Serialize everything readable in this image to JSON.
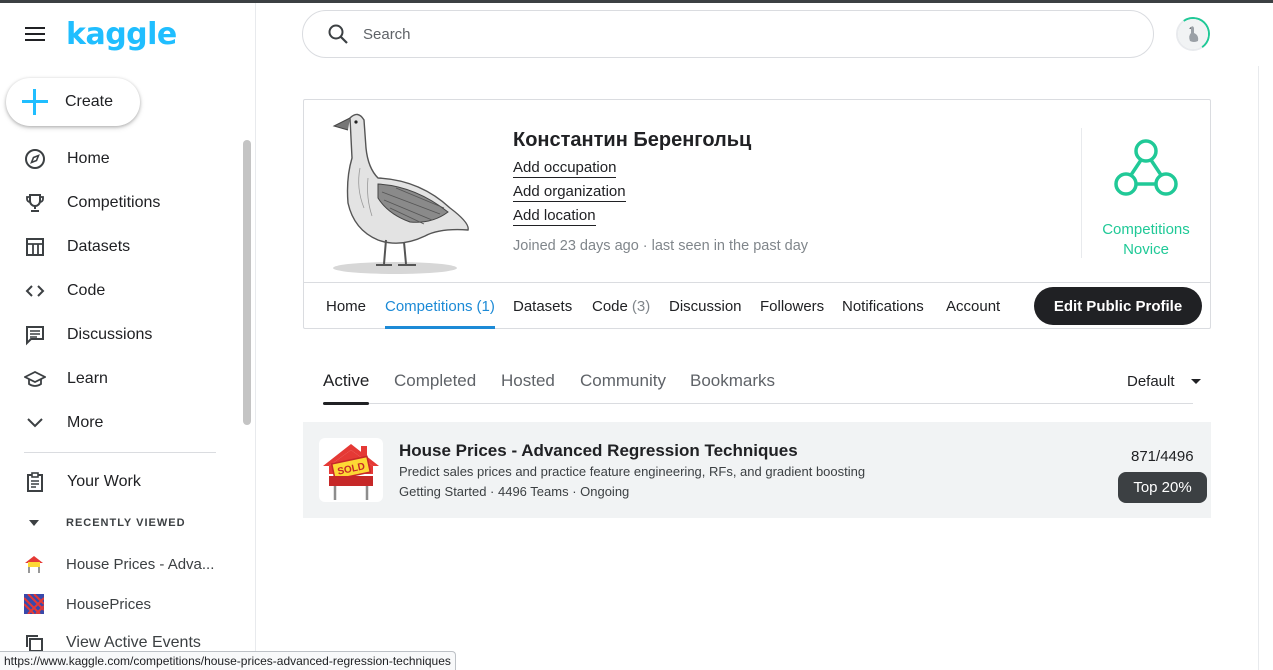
{
  "app": {
    "logo": "kaggle"
  },
  "sidebar": {
    "create_label": "Create",
    "items": [
      {
        "label": "Home",
        "icon": "compass-icon"
      },
      {
        "label": "Competitions",
        "icon": "trophy-icon"
      },
      {
        "label": "Datasets",
        "icon": "table-icon"
      },
      {
        "label": "Code",
        "icon": "code-icon"
      },
      {
        "label": "Discussions",
        "icon": "comment-icon"
      },
      {
        "label": "Learn",
        "icon": "school-icon"
      },
      {
        "label": "More",
        "icon": "chevron-down-icon"
      }
    ],
    "your_work": "Your Work",
    "recently_viewed": "RECENTLY VIEWED",
    "recent": [
      {
        "label": "House Prices - Adva..."
      },
      {
        "label": "HousePrices"
      },
      {
        "label": "View Active Events"
      }
    ]
  },
  "search": {
    "placeholder": "Search"
  },
  "profile": {
    "name": "Константин Беренгольц",
    "add_occupation": "Add occupation",
    "add_organization": "Add organization",
    "add_location": "Add location",
    "meta": "Joined 23 days ago · last seen in the past day",
    "tier": {
      "line1": "Competitions",
      "line2": "Novice",
      "color": "#20c997"
    },
    "tabs": [
      {
        "label": "Home",
        "count": ""
      },
      {
        "label": "Competitions",
        "count": "(1)"
      },
      {
        "label": "Datasets",
        "count": ""
      },
      {
        "label": "Code",
        "count": "(3)"
      },
      {
        "label": "Discussion",
        "count": ""
      },
      {
        "label": "Followers",
        "count": ""
      },
      {
        "label": "Notifications",
        "count": ""
      },
      {
        "label": "Account",
        "count": ""
      }
    ],
    "edit_button": "Edit Public Profile"
  },
  "subtabs": [
    "Active",
    "Completed",
    "Hosted",
    "Community",
    "Bookmarks"
  ],
  "sort_label": "Default",
  "competition": {
    "title": "House Prices - Advanced Regression Techniques",
    "description": "Predict sales prices and practice feature engineering, RFs, and gradient boosting",
    "meta": "Getting Started · 4496 Teams · Ongoing",
    "rank": "871/4496",
    "badge": "Top 20%",
    "thumb_text": "SOLD"
  },
  "status_url": "https://www.kaggle.com/competitions/house-prices-advanced-regression-techniques",
  "colors": {
    "accent": "#20beff",
    "tab_active": "#1c8ad6",
    "tier": "#20c997"
  }
}
